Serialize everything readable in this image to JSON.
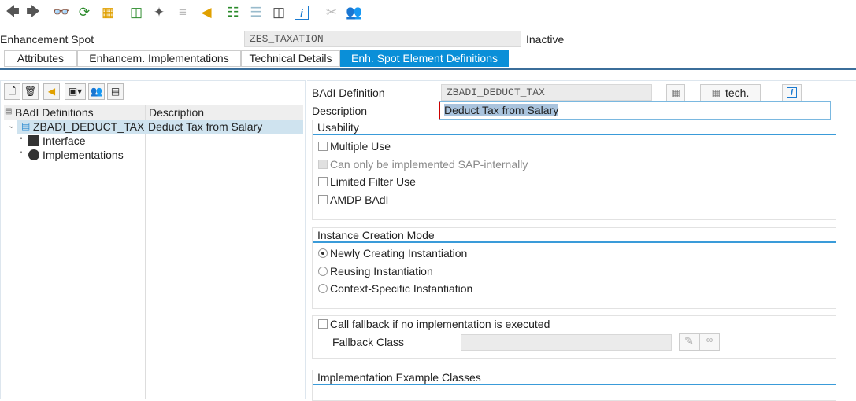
{
  "toolbar": {
    "icons": [
      "back-icon",
      "forward-icon",
      "display-change-icon",
      "check-icon",
      "activate-icon",
      "where-used-icon",
      "wizard-icon",
      "disabled-icon",
      "hierarchy-icon",
      "org-chart-icon",
      "list-icon",
      "window-icon",
      "info-icon",
      "disabled-cut-icon",
      "users-icon"
    ]
  },
  "header": {
    "spot_label": "Enhancement Spot",
    "spot_value": "ZES_TAXATION",
    "status": "Inactive"
  },
  "tabs": [
    {
      "label": "Attributes"
    },
    {
      "label": "Enhancem. Implementations"
    },
    {
      "label": "Technical Details"
    },
    {
      "label": "Enh. Spot Element Definitions"
    }
  ],
  "tree": {
    "col1": "BAdI Definitions",
    "col2": "Description",
    "root": {
      "name": "ZBADI_DEDUCT_TAX",
      "description": "Deduct Tax from Salary"
    },
    "children": [
      {
        "label": "Interface"
      },
      {
        "label": "Implementations"
      }
    ]
  },
  "detail": {
    "badi_label": "BAdI Definition",
    "badi_value": "ZBADI_DEDUCT_TAX",
    "tech_label": "tech.",
    "desc_label": "Description",
    "desc_value": "Deduct Tax from Salary",
    "usability": {
      "title": "Usability",
      "items": [
        {
          "label": "Multiple Use",
          "checked": false,
          "disabled": false
        },
        {
          "label": "Can only be implemented SAP-internally",
          "checked": false,
          "disabled": true
        },
        {
          "label": "Limited Filter Use",
          "checked": false,
          "disabled": false
        },
        {
          "label": "AMDP BAdI",
          "checked": false,
          "disabled": false
        }
      ]
    },
    "instance": {
      "title": "Instance Creation Mode",
      "options": [
        {
          "label": "Newly Creating Instantiation",
          "selected": true
        },
        {
          "label": "Reusing Instantiation",
          "selected": false
        },
        {
          "label": "Context-Specific Instantiation",
          "selected": false
        }
      ]
    },
    "fallback": {
      "check_label": "Call fallback if no implementation is executed",
      "class_label": "Fallback Class",
      "class_value": ""
    },
    "examples": {
      "title": "Implementation Example Classes"
    }
  }
}
